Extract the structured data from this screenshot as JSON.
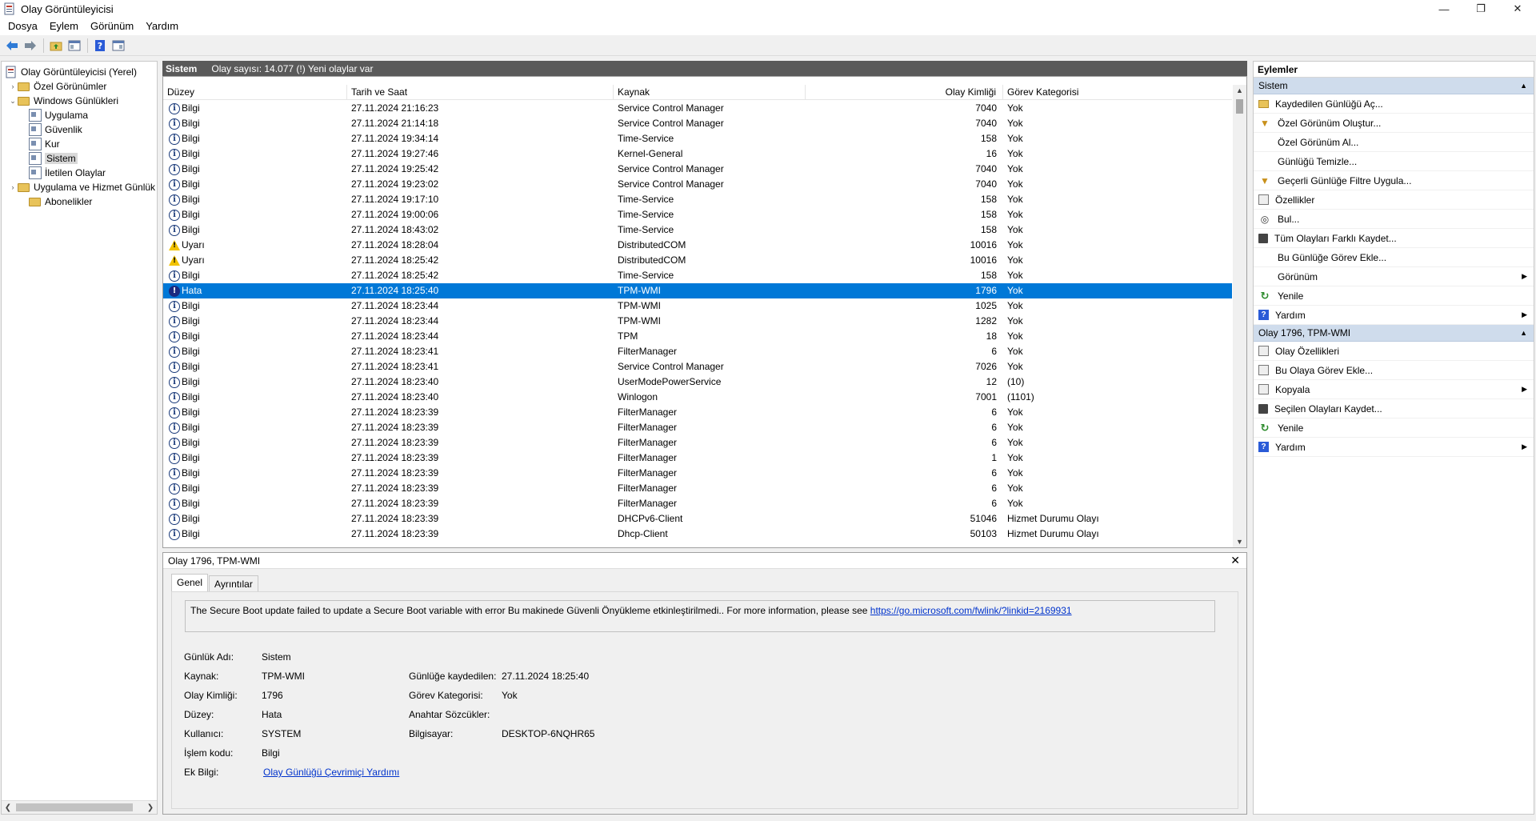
{
  "window": {
    "title": "Olay Görüntüleyicisi"
  },
  "menu": [
    "Dosya",
    "Eylem",
    "Görünüm",
    "Yardım"
  ],
  "tree": [
    {
      "label": "Olay Görüntüleyicisi (Yerel)",
      "icon": "event-viewer-icon",
      "level": 0,
      "expander": ""
    },
    {
      "label": "Özel Görünümler",
      "icon": "folder-icon",
      "level": 1,
      "expander": "›"
    },
    {
      "label": "Windows Günlükleri",
      "icon": "folder-icon",
      "level": 1,
      "expander": "⌄"
    },
    {
      "label": "Uygulama",
      "icon": "log-icon",
      "level": 2,
      "expander": ""
    },
    {
      "label": "Güvenlik",
      "icon": "log-icon",
      "level": 2,
      "expander": ""
    },
    {
      "label": "Kur",
      "icon": "log-icon",
      "level": 2,
      "expander": ""
    },
    {
      "label": "Sistem",
      "icon": "log-icon",
      "level": 2,
      "expander": "",
      "selected": true
    },
    {
      "label": "İletilen Olaylar",
      "icon": "log-icon",
      "level": 2,
      "expander": ""
    },
    {
      "label": "Uygulama ve Hizmet Günlük",
      "icon": "folder-icon",
      "level": 1,
      "expander": "›"
    },
    {
      "label": "Abonelikler",
      "icon": "folder-icon",
      "level": 1,
      "expander": ""
    }
  ],
  "center": {
    "title": "Sistem",
    "count_text": "Olay sayısı: 14.077 (!) Yeni olaylar var"
  },
  "columns": [
    "Düzey",
    "Tarih ve Saat",
    "Kaynak",
    "Olay Kimliği",
    "Görev Kategorisi"
  ],
  "events": [
    {
      "level": "Bilgi",
      "type": "info",
      "date": "27.11.2024 21:16:23",
      "source": "Service Control Manager",
      "id": "7040",
      "task": "Yok"
    },
    {
      "level": "Bilgi",
      "type": "info",
      "date": "27.11.2024 21:14:18",
      "source": "Service Control Manager",
      "id": "7040",
      "task": "Yok"
    },
    {
      "level": "Bilgi",
      "type": "info",
      "date": "27.11.2024 19:34:14",
      "source": "Time-Service",
      "id": "158",
      "task": "Yok"
    },
    {
      "level": "Bilgi",
      "type": "info",
      "date": "27.11.2024 19:27:46",
      "source": "Kernel-General",
      "id": "16",
      "task": "Yok"
    },
    {
      "level": "Bilgi",
      "type": "info",
      "date": "27.11.2024 19:25:42",
      "source": "Service Control Manager",
      "id": "7040",
      "task": "Yok"
    },
    {
      "level": "Bilgi",
      "type": "info",
      "date": "27.11.2024 19:23:02",
      "source": "Service Control Manager",
      "id": "7040",
      "task": "Yok"
    },
    {
      "level": "Bilgi",
      "type": "info",
      "date": "27.11.2024 19:17:10",
      "source": "Time-Service",
      "id": "158",
      "task": "Yok"
    },
    {
      "level": "Bilgi",
      "type": "info",
      "date": "27.11.2024 19:00:06",
      "source": "Time-Service",
      "id": "158",
      "task": "Yok"
    },
    {
      "level": "Bilgi",
      "type": "info",
      "date": "27.11.2024 18:43:02",
      "source": "Time-Service",
      "id": "158",
      "task": "Yok"
    },
    {
      "level": "Uyarı",
      "type": "warn",
      "date": "27.11.2024 18:28:04",
      "source": "DistributedCOM",
      "id": "10016",
      "task": "Yok"
    },
    {
      "level": "Uyarı",
      "type": "warn",
      "date": "27.11.2024 18:25:42",
      "source": "DistributedCOM",
      "id": "10016",
      "task": "Yok"
    },
    {
      "level": "Bilgi",
      "type": "info",
      "date": "27.11.2024 18:25:42",
      "source": "Time-Service",
      "id": "158",
      "task": "Yok"
    },
    {
      "level": "Hata",
      "type": "error",
      "date": "27.11.2024 18:25:40",
      "source": "TPM-WMI",
      "id": "1796",
      "task": "Yok",
      "selected": true
    },
    {
      "level": "Bilgi",
      "type": "info",
      "date": "27.11.2024 18:23:44",
      "source": "TPM-WMI",
      "id": "1025",
      "task": "Yok"
    },
    {
      "level": "Bilgi",
      "type": "info",
      "date": "27.11.2024 18:23:44",
      "source": "TPM-WMI",
      "id": "1282",
      "task": "Yok"
    },
    {
      "level": "Bilgi",
      "type": "info",
      "date": "27.11.2024 18:23:44",
      "source": "TPM",
      "id": "18",
      "task": "Yok"
    },
    {
      "level": "Bilgi",
      "type": "info",
      "date": "27.11.2024 18:23:41",
      "source": "FilterManager",
      "id": "6",
      "task": "Yok"
    },
    {
      "level": "Bilgi",
      "type": "info",
      "date": "27.11.2024 18:23:41",
      "source": "Service Control Manager",
      "id": "7026",
      "task": "Yok"
    },
    {
      "level": "Bilgi",
      "type": "info",
      "date": "27.11.2024 18:23:40",
      "source": "UserModePowerService",
      "id": "12",
      "task": "(10)"
    },
    {
      "level": "Bilgi",
      "type": "info",
      "date": "27.11.2024 18:23:40",
      "source": "Winlogon",
      "id": "7001",
      "task": "(1101)"
    },
    {
      "level": "Bilgi",
      "type": "info",
      "date": "27.11.2024 18:23:39",
      "source": "FilterManager",
      "id": "6",
      "task": "Yok"
    },
    {
      "level": "Bilgi",
      "type": "info",
      "date": "27.11.2024 18:23:39",
      "source": "FilterManager",
      "id": "6",
      "task": "Yok"
    },
    {
      "level": "Bilgi",
      "type": "info",
      "date": "27.11.2024 18:23:39",
      "source": "FilterManager",
      "id": "6",
      "task": "Yok"
    },
    {
      "level": "Bilgi",
      "type": "info",
      "date": "27.11.2024 18:23:39",
      "source": "FilterManager",
      "id": "1",
      "task": "Yok"
    },
    {
      "level": "Bilgi",
      "type": "info",
      "date": "27.11.2024 18:23:39",
      "source": "FilterManager",
      "id": "6",
      "task": "Yok"
    },
    {
      "level": "Bilgi",
      "type": "info",
      "date": "27.11.2024 18:23:39",
      "source": "FilterManager",
      "id": "6",
      "task": "Yok"
    },
    {
      "level": "Bilgi",
      "type": "info",
      "date": "27.11.2024 18:23:39",
      "source": "FilterManager",
      "id": "6",
      "task": "Yok"
    },
    {
      "level": "Bilgi",
      "type": "info",
      "date": "27.11.2024 18:23:39",
      "source": "DHCPv6-Client",
      "id": "51046",
      "task": "Hizmet Durumu Olayı"
    },
    {
      "level": "Bilgi",
      "type": "info",
      "date": "27.11.2024 18:23:39",
      "source": "Dhcp-Client",
      "id": "50103",
      "task": "Hizmet Durumu Olayı"
    }
  ],
  "detail": {
    "title": "Olay 1796, TPM-WMI",
    "tabs": [
      "Genel",
      "Ayrıntılar"
    ],
    "message": "The Secure Boot update failed to update a Secure Boot variable with error Bu makinede Güvenli Önyükleme etkinleştirilmedi.. For more information, please see ",
    "message_link": "https://go.microsoft.com/fwlink/?linkid=2169931",
    "props": {
      "log_name_label": "Günlük Adı:",
      "log_name": "Sistem",
      "source_label": "Kaynak:",
      "source": "TPM-WMI",
      "logged_label": "Günlüğe kaydedilen:",
      "logged": "27.11.2024 18:25:40",
      "event_id_label": "Olay Kimliği:",
      "event_id": "1796",
      "task_label": "Görev Kategorisi:",
      "task": "Yok",
      "level_label": "Düzey:",
      "level": "Hata",
      "keywords_label": "Anahtar Sözcükler:",
      "keywords": "",
      "user_label": "Kullanıcı:",
      "user": "SYSTEM",
      "computer_label": "Bilgisayar:",
      "computer": "DESKTOP-6NQHR65",
      "opcode_label": "İşlem kodu:",
      "opcode": "Bilgi",
      "more_info_label": "Ek Bilgi:",
      "more_info_link": "Olay Günlüğü Çevrimiçi Yardımı"
    }
  },
  "actions": {
    "title": "Eylemler",
    "sections": [
      {
        "title": "Sistem",
        "items": [
          {
            "label": "Kaydedilen Günlüğü Aç...",
            "icon": "folder-open-icon"
          },
          {
            "label": "Özel Görünüm Oluştur...",
            "icon": "filter-icon"
          },
          {
            "label": "Özel Görünüm Al...",
            "icon": ""
          },
          {
            "label": "Günlüğü Temizle...",
            "icon": ""
          },
          {
            "label": "Geçerli Günlüğe Filtre Uygula...",
            "icon": "filter-icon"
          },
          {
            "label": "Özellikler",
            "icon": "properties-icon"
          },
          {
            "label": "Bul...",
            "icon": "binoculars-icon"
          },
          {
            "label": "Tüm Olayları Farklı Kaydet...",
            "icon": "save-icon"
          },
          {
            "label": "Bu Günlüğe Görev Ekle...",
            "icon": ""
          },
          {
            "label": "Görünüm",
            "icon": "",
            "submenu": true
          },
          {
            "label": "Yenile",
            "icon": "refresh-icon"
          },
          {
            "label": "Yardım",
            "icon": "help-icon",
            "submenu": true
          }
        ]
      },
      {
        "title": "Olay 1796, TPM-WMI",
        "items": [
          {
            "label": "Olay Özellikleri",
            "icon": "properties-icon"
          },
          {
            "label": "Bu Olaya Görev Ekle...",
            "icon": "task-icon"
          },
          {
            "label": "Kopyala",
            "icon": "copy-icon",
            "submenu": true
          },
          {
            "label": "Seçilen Olayları Kaydet...",
            "icon": "save-icon"
          },
          {
            "label": "Yenile",
            "icon": "refresh-icon"
          },
          {
            "label": "Yardım",
            "icon": "help-icon",
            "submenu": true
          }
        ]
      }
    ]
  }
}
